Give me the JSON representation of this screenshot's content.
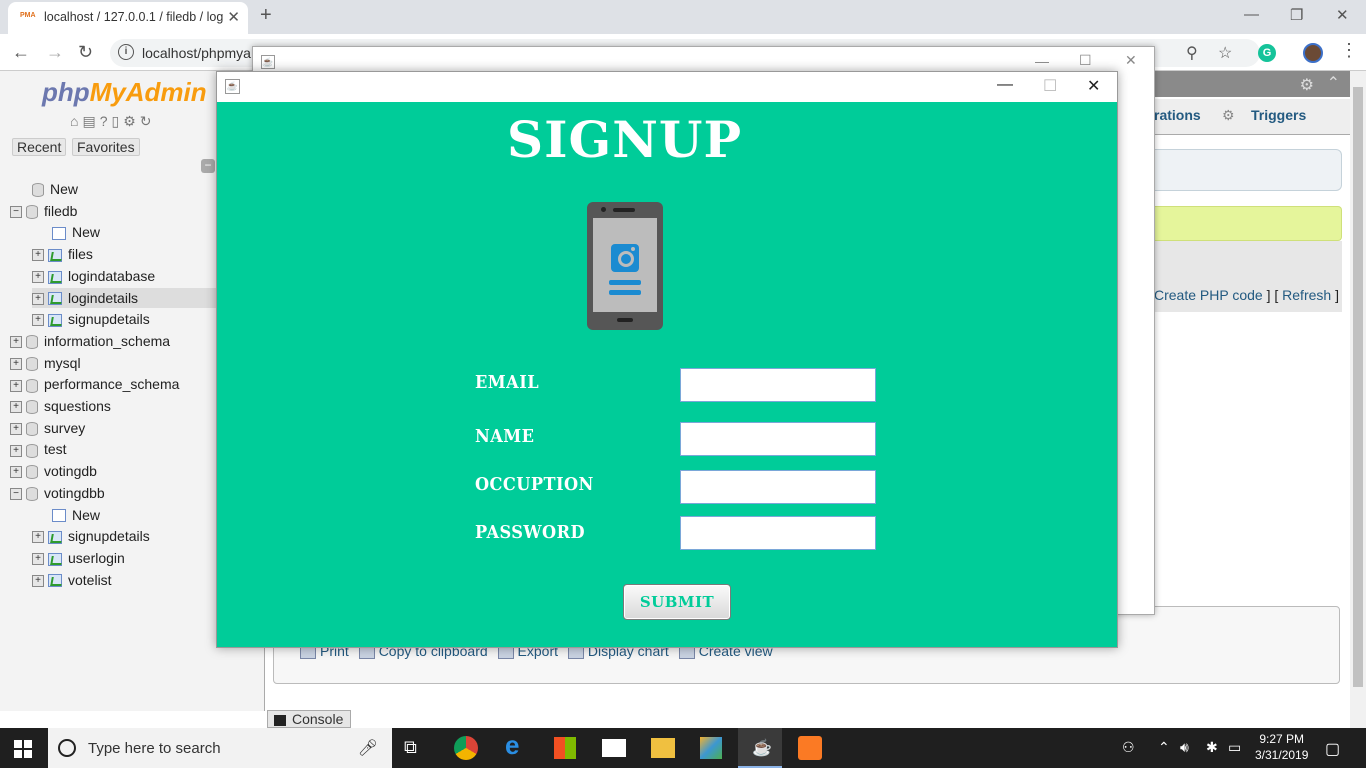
{
  "browser": {
    "tab_title": "localhost / 127.0.0.1 / filedb / log",
    "url": "localhost/phpmya"
  },
  "pma": {
    "logo_a": "php",
    "logo_b": "MyAdmin",
    "tabs": {
      "recent": "Recent",
      "favorites": "Favorites"
    },
    "tree": [
      {
        "label": "New",
        "type": "new-root",
        "level": 0
      },
      {
        "label": "filedb",
        "type": "db",
        "expanded": true,
        "level": 0
      },
      {
        "label": "New",
        "type": "new",
        "level": 1
      },
      {
        "label": "files",
        "type": "table",
        "level": 1
      },
      {
        "label": "logindatabase",
        "type": "table",
        "level": 1
      },
      {
        "label": "logindetails",
        "type": "table",
        "level": 1,
        "selected": true
      },
      {
        "label": "signupdetails",
        "type": "table",
        "level": 1
      },
      {
        "label": "information_schema",
        "type": "db",
        "level": 0
      },
      {
        "label": "mysql",
        "type": "db",
        "level": 0
      },
      {
        "label": "performance_schema",
        "type": "db",
        "level": 0
      },
      {
        "label": "squestions",
        "type": "db",
        "level": 0
      },
      {
        "label": "survey",
        "type": "db",
        "level": 0
      },
      {
        "label": "test",
        "type": "db",
        "level": 0
      },
      {
        "label": "votingdb",
        "type": "db",
        "level": 0
      },
      {
        "label": "votingdbb",
        "type": "db",
        "expanded": true,
        "level": 0
      },
      {
        "label": "New",
        "type": "new",
        "level": 1
      },
      {
        "label": "signupdetails",
        "type": "table",
        "level": 1
      },
      {
        "label": "userlogin",
        "type": "table",
        "level": 1
      },
      {
        "label": "votelist",
        "type": "table",
        "level": 1
      }
    ],
    "top_tabs": {
      "operations": "rations",
      "triggers": "Triggers"
    },
    "links": {
      "create_php": "Create PHP code",
      "refresh": "Refresh",
      "sep1": " ] [ ",
      "end": " ]"
    },
    "ops": {
      "print": "Print",
      "copy": "Copy to clipboard",
      "export": "Export",
      "chart": "Display chart",
      "view": "Create view"
    },
    "console": "Console"
  },
  "signup": {
    "title": "SIGNUP",
    "fields": [
      {
        "label": "EMAIL",
        "value": ""
      },
      {
        "label": "NAME",
        "value": ""
      },
      {
        "label": "OCCUPTION",
        "value": ""
      },
      {
        "label": "PASSWORD",
        "value": ""
      }
    ],
    "submit": "SUBMIT",
    "bg_color": "#00cc99"
  },
  "taskbar": {
    "search_placeholder": "Type here to search",
    "time": "9:27 PM",
    "date": "3/31/2019"
  }
}
